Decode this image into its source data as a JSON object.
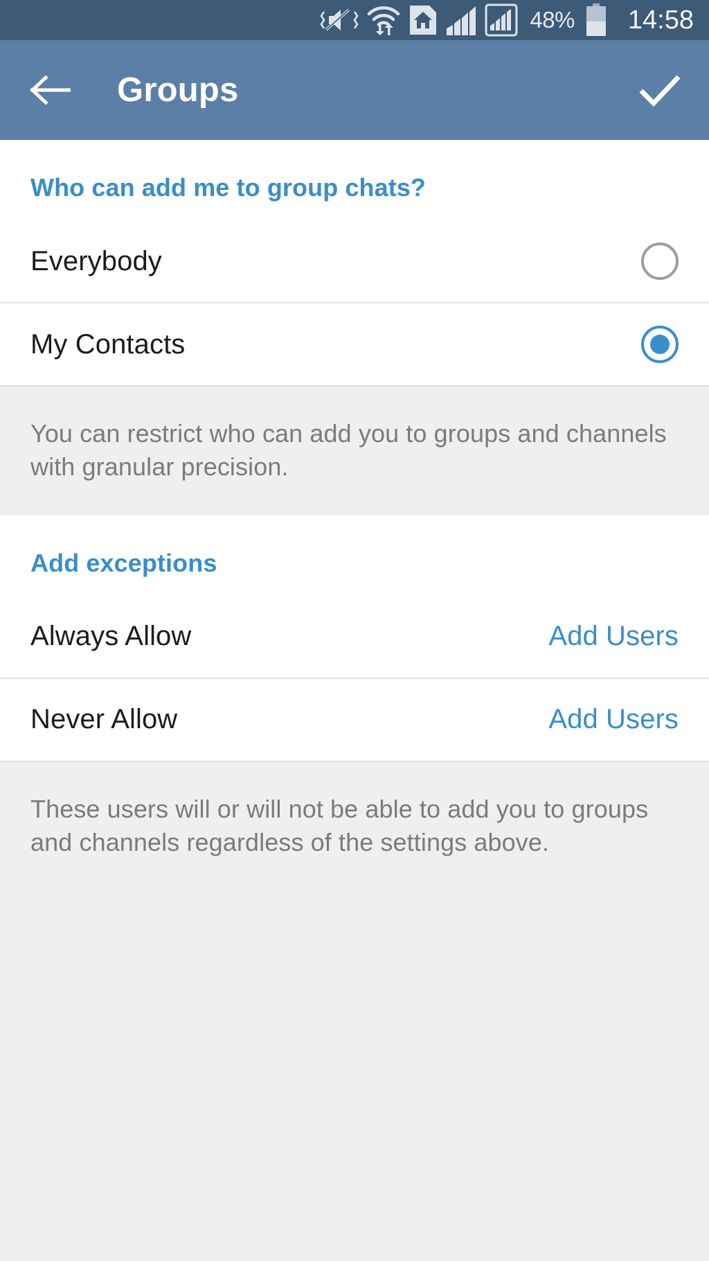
{
  "status_bar": {
    "battery_percent": "48%",
    "time": "14:58",
    "icons": [
      "mute-vibrate-icon",
      "wifi-icon",
      "sim-home-icon",
      "signal-bars-icon",
      "signal-boxed-icon",
      "battery-icon"
    ],
    "background_color": "#3d5a77",
    "text_color": "#e6eaef"
  },
  "app_bar": {
    "title": "Groups",
    "back_icon": "back-arrow-icon",
    "done_icon": "checkmark-icon",
    "background_color": "#5b7fa6",
    "title_color": "#ffffff"
  },
  "privacy_section": {
    "header": "Who can add me to group chats?",
    "options": [
      {
        "label": "Everybody",
        "selected": false
      },
      {
        "label": "My Contacts",
        "selected": true
      }
    ],
    "footer": "You can restrict who can add you to groups and channels with granular precision."
  },
  "exceptions_section": {
    "header": "Add exceptions",
    "rows": [
      {
        "label": "Always Allow",
        "action": "Add Users"
      },
      {
        "label": "Never Allow",
        "action": "Add Users"
      }
    ],
    "footer": "These users will or will not be able to add you to groups and channels regardless of the settings above."
  },
  "colors": {
    "accent": "#3a8ec9",
    "primary_text": "#1c1c1c",
    "secondary_text": "#7b7b7b",
    "section_bg": "#efefef"
  }
}
